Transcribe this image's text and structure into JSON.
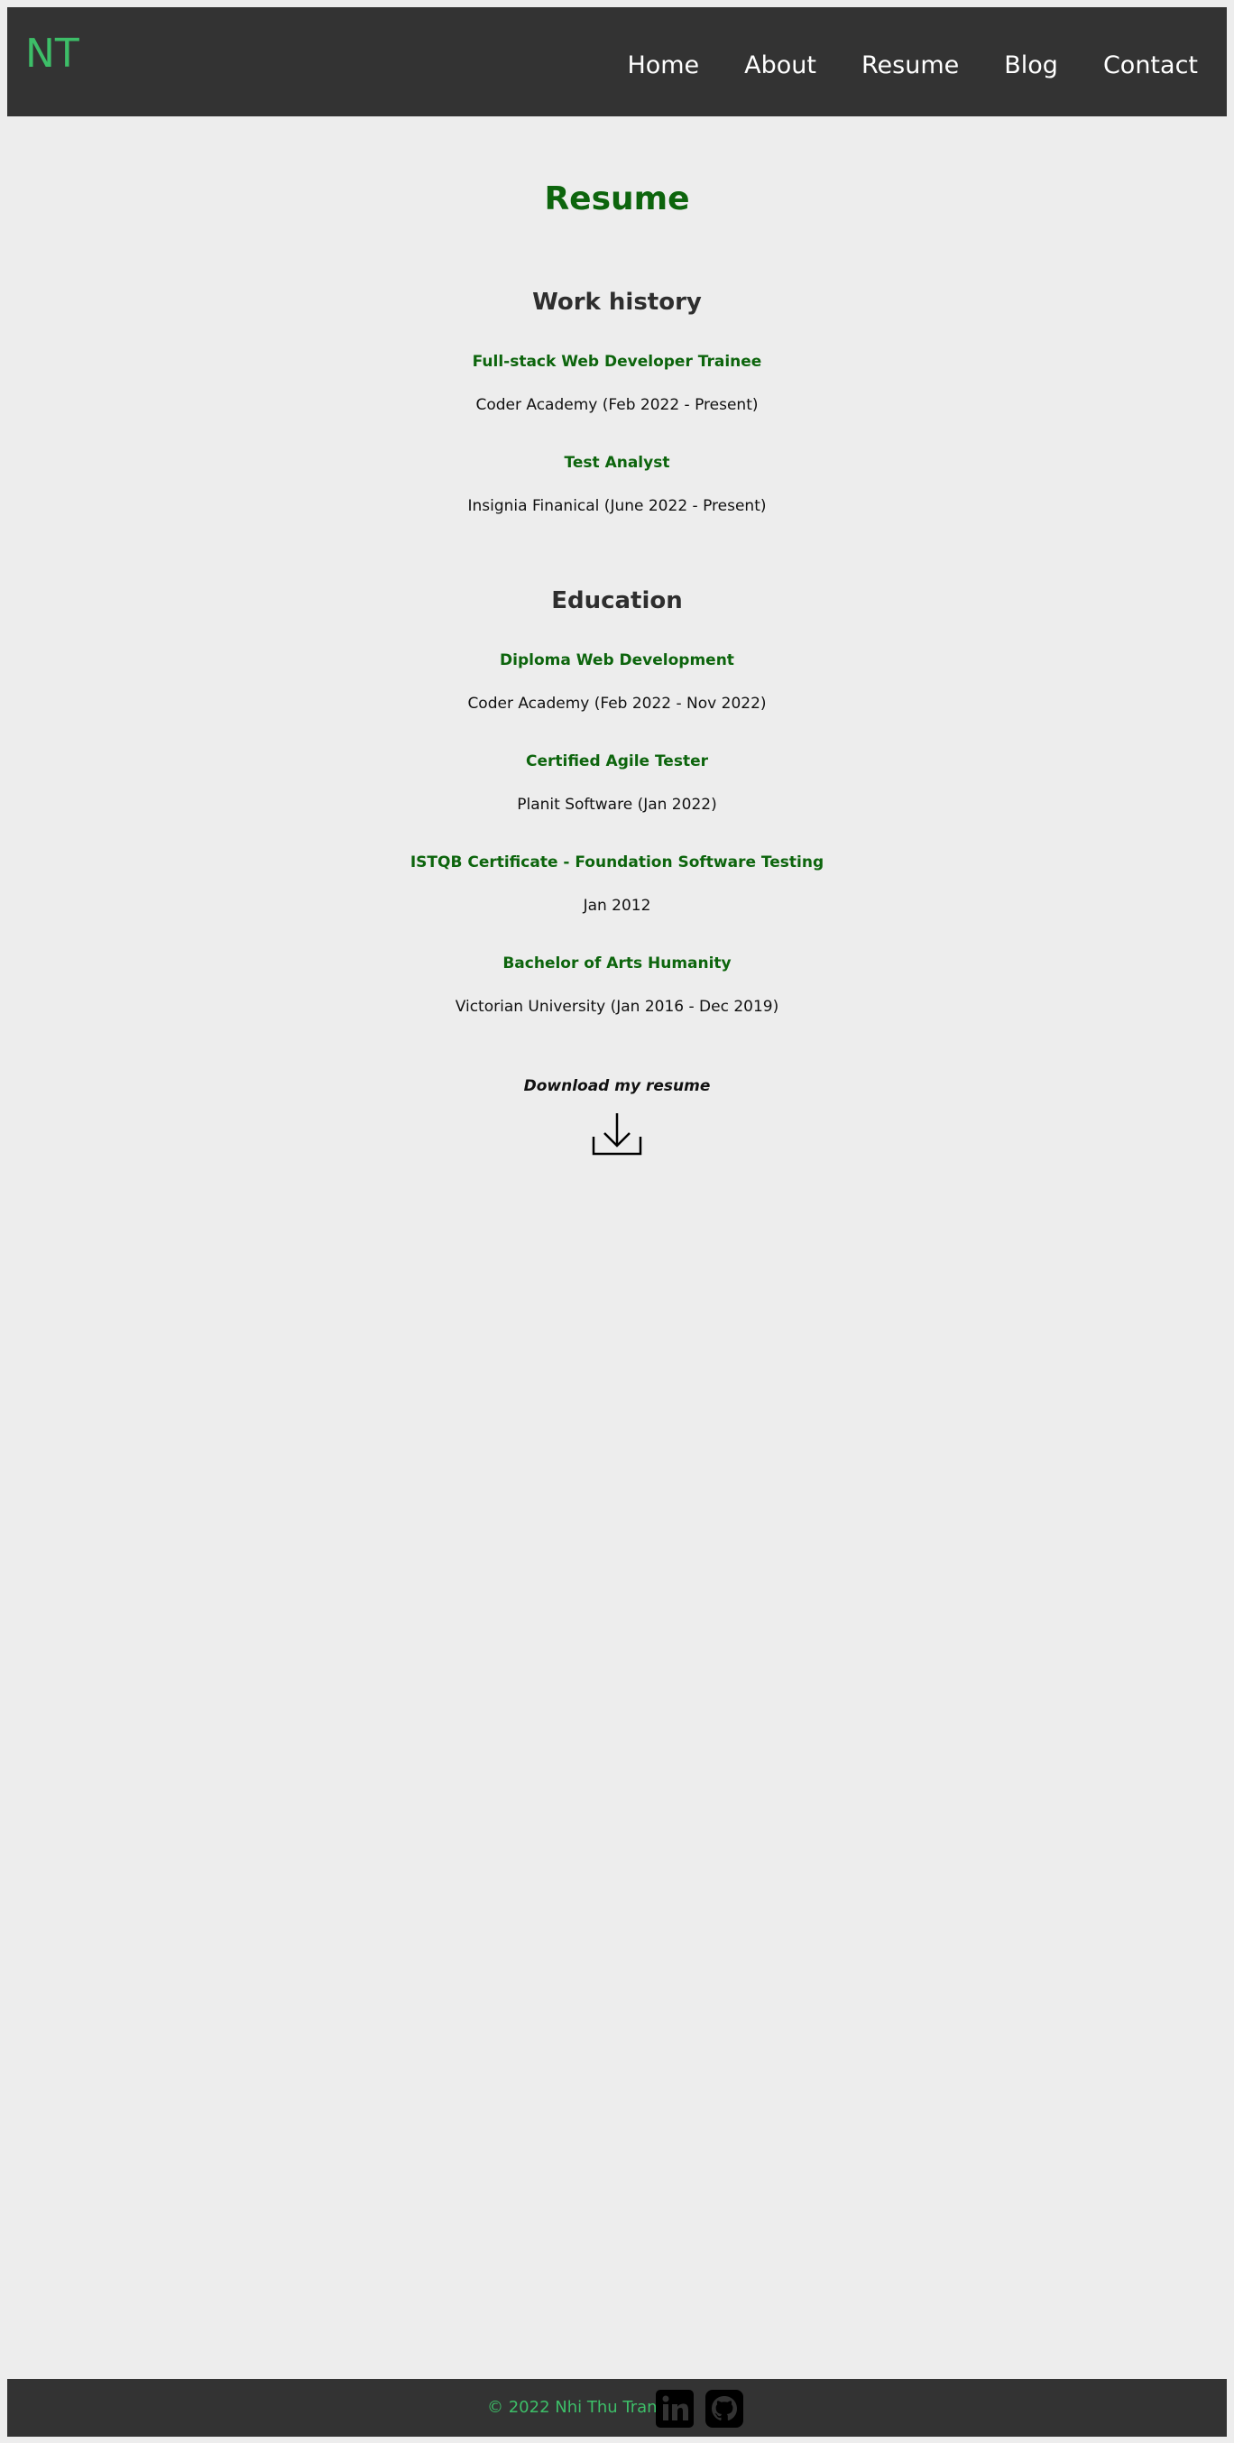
{
  "header": {
    "logo": "NT",
    "nav": [
      "Home",
      "About",
      "Resume",
      "Blog",
      "Contact"
    ]
  },
  "page": {
    "title": "Resume"
  },
  "work_history": {
    "title": "Work history",
    "items": [
      {
        "role": "Full-stack Web Developer Trainee",
        "detail": "Coder Academy (Feb 2022 - Present)"
      },
      {
        "role": "Test Analyst",
        "detail": "Insignia Finanical (June 2022 - Present)"
      }
    ]
  },
  "education": {
    "title": "Education",
    "items": [
      {
        "role": "Diploma Web Development",
        "detail": "Coder Academy (Feb 2022 - Nov 2022)"
      },
      {
        "role": "Certified Agile Tester",
        "detail": "Planit Software (Jan 2022)"
      },
      {
        "role": "ISTQB Certificate - Foundation Software Testing",
        "detail": "Jan 2012"
      },
      {
        "role": "Bachelor of Arts Humanity",
        "detail": "Victorian University (Jan 2016 - Dec 2019)"
      }
    ]
  },
  "download": {
    "label": "Download my resume",
    "icon": "download-icon"
  },
  "footer": {
    "copyright": "© 2022 Nhi Thu Tran",
    "social": [
      "linkedin-icon",
      "github-icon"
    ]
  },
  "colors": {
    "header_bg": "#333333",
    "page_bg": "#ededed",
    "accent_green": "#3dbe68",
    "heading_green": "#0d650d"
  }
}
